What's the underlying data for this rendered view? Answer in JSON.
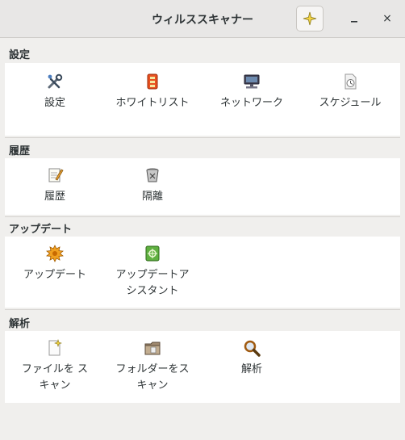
{
  "window": {
    "title": "ウィルススキャナー",
    "close_glyph": "×",
    "minimize_glyph": "_"
  },
  "sections": [
    {
      "title": "設定",
      "items": [
        {
          "label": "設定",
          "icon": "tools-icon"
        },
        {
          "label": "ホワイトリスト",
          "icon": "whitelist-icon"
        },
        {
          "label": "ネットワーク",
          "icon": "network-icon"
        },
        {
          "label": "スケジュール",
          "icon": "schedule-icon"
        }
      ]
    },
    {
      "title": "履歴",
      "items": [
        {
          "label": "履歴",
          "icon": "history-icon"
        },
        {
          "label": "隔離",
          "icon": "quarantine-icon"
        }
      ]
    },
    {
      "title": "アップデート",
      "items": [
        {
          "label": "アップデート",
          "icon": "update-icon"
        },
        {
          "label": "アップデートア\nシスタント",
          "icon": "update-assistant-icon"
        }
      ]
    },
    {
      "title": "解析",
      "items": [
        {
          "label": "ファイルを ス\nキャン",
          "icon": "scan-file-icon"
        },
        {
          "label": "フォルダーをス\nキャン",
          "icon": "scan-folder-icon"
        },
        {
          "label": "解析",
          "icon": "analysis-icon"
        }
      ]
    }
  ]
}
